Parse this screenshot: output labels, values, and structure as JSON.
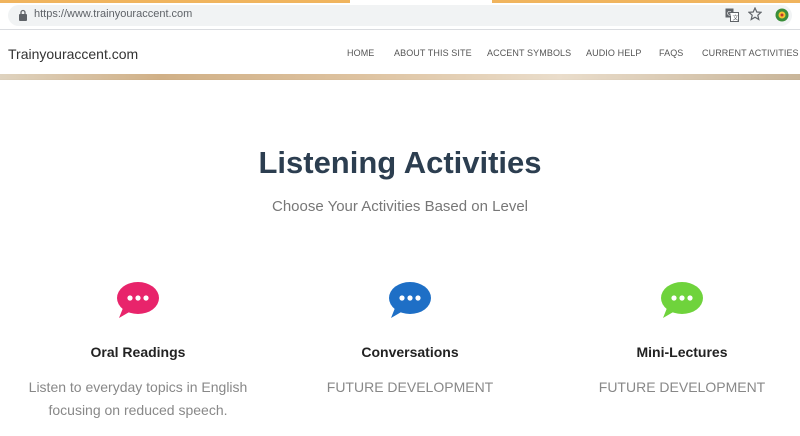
{
  "browser": {
    "url": "https://www.trainyouraccent.com"
  },
  "navbar": {
    "brand": "Trainyouraccent.com",
    "links": [
      {
        "label": "HOME"
      },
      {
        "label": "ABOUT THIS SITE"
      },
      {
        "label": "ACCENT SYMBOLS"
      },
      {
        "label": "AUDIO HELP"
      },
      {
        "label": "FAQS"
      },
      {
        "label": "CURRENT ACTIVITIES"
      }
    ]
  },
  "main": {
    "title": "Listening Activities",
    "subtitle": "Choose Your Activities Based on Level",
    "cards": [
      {
        "title": "Oral Readings",
        "text": "Listen to everyday topics in English focusing on reduced speech.",
        "icon": "speech-bubble-icon",
        "color": "#e8246b"
      },
      {
        "title": "Conversations",
        "text": "FUTURE DEVELOPMENT",
        "icon": "speech-bubble-icon",
        "color": "#1e6fc6"
      },
      {
        "title": "Mini-Lectures",
        "text": "FUTURE DEVELOPMENT",
        "icon": "speech-bubble-icon",
        "color": "#6fd33c"
      }
    ]
  }
}
